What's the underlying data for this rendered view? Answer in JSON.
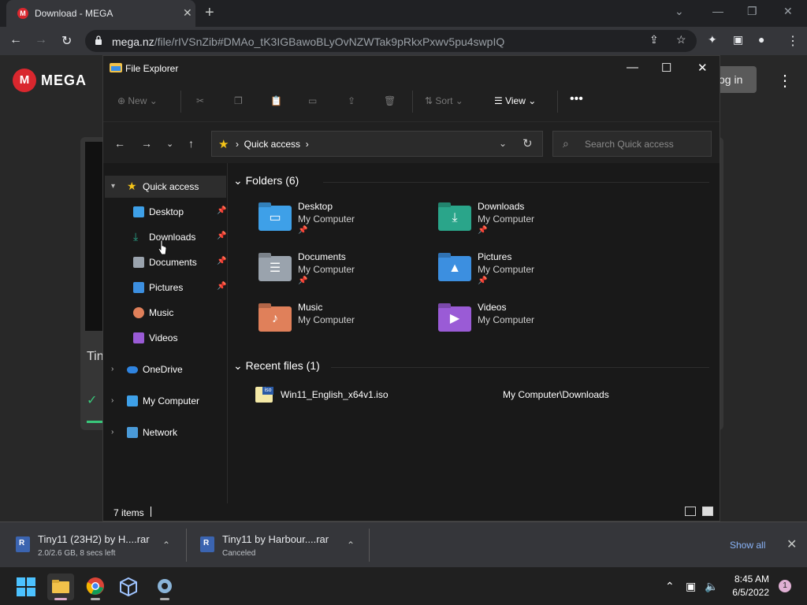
{
  "browser": {
    "tab_title": "Download - MEGA",
    "url_host": "mega.nz",
    "url_path": "/file/rIVSnZib#DMAo_tK3IGBawoBLyOvNZWTak9pRkxPxwv5pu4swpIQ"
  },
  "mega": {
    "brand": "MEGA",
    "login_label": "og in",
    "card_text": "Tin"
  },
  "explorer": {
    "title": "File Explorer",
    "commands": {
      "new": "New",
      "sort": "Sort",
      "view": "View"
    },
    "address": "Quick access",
    "search_placeholder": "Search Quick access",
    "sidebar": [
      {
        "label": "Quick access"
      },
      {
        "label": "Desktop"
      },
      {
        "label": "Downloads"
      },
      {
        "label": "Documents"
      },
      {
        "label": "Pictures"
      },
      {
        "label": "Music"
      },
      {
        "label": "Videos"
      },
      {
        "label": "OneDrive"
      },
      {
        "label": "My Computer"
      },
      {
        "label": "Network"
      }
    ],
    "folders_header": "Folders (6)",
    "folders": [
      {
        "name": "Desktop",
        "location": "My Computer",
        "color": "#3ea0e8"
      },
      {
        "name": "Downloads",
        "location": "My Computer",
        "color": "#2aa58a"
      },
      {
        "name": "Documents",
        "location": "My Computer",
        "color": "#9aa3ad"
      },
      {
        "name": "Pictures",
        "location": "My Computer",
        "color": "#3c8fe0"
      },
      {
        "name": "Music",
        "location": "My Computer",
        "color": "#e0805a"
      },
      {
        "name": "Videos",
        "location": "My Computer",
        "color": "#9a5bd6"
      }
    ],
    "recent_header": "Recent files (1)",
    "recent": [
      {
        "name": "Win11_English_x64v1.iso",
        "path": "My Computer\\Downloads"
      }
    ],
    "status": "7 items"
  },
  "downloads": [
    {
      "name": "Tiny11 (23H2) by H....rar",
      "status": "2.0/2.6 GB, 8 secs left"
    },
    {
      "name": "Tiny11 by Harbour....rar",
      "status": "Canceled"
    }
  ],
  "downloads_show_all": "Show all",
  "taskbar": {
    "time": "8:45 AM",
    "date": "6/5/2022",
    "notifications": "1"
  }
}
